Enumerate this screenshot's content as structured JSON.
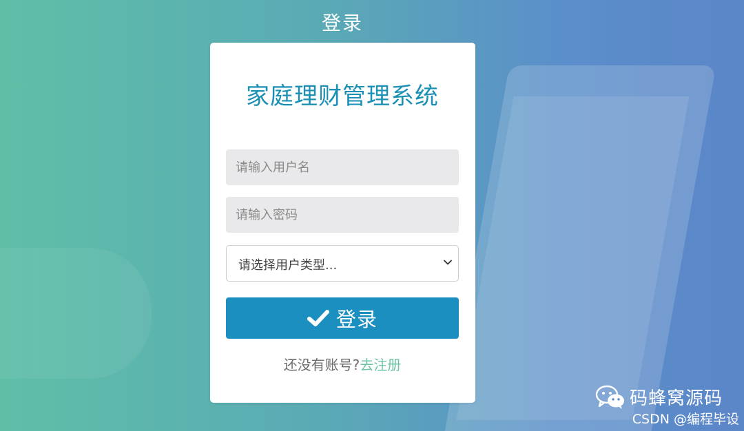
{
  "page": {
    "title": "登录"
  },
  "card": {
    "system_title": "家庭理财管理系统",
    "username": {
      "placeholder": "请输入用户名",
      "value": ""
    },
    "password": {
      "placeholder": "请输入密码",
      "value": ""
    },
    "user_type": {
      "selected": "请选择用户类型..."
    },
    "login_button": {
      "label": "登录",
      "icon": "check-icon"
    },
    "register": {
      "prompt": "还没有账号?",
      "link_label": "去注册"
    }
  },
  "watermark": {
    "brand": "码蜂窝源码",
    "csdn": "CSDN @编程毕设",
    "icon": "wechat-icon"
  },
  "colors": {
    "accent": "#1a8fc0",
    "title": "#1b8fb4",
    "link": "#6cc4a2",
    "background_from": "#5fbfa6",
    "background_to": "#5b86c8"
  }
}
